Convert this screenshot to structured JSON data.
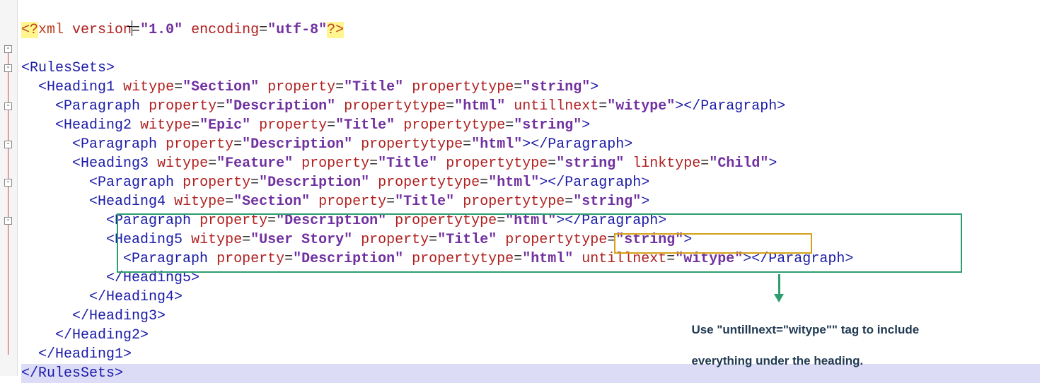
{
  "line01": {
    "pi_open": "<?",
    "pi_name": "xml",
    "attr1": "version",
    "val1": "\"1.0\"",
    "attr2": "encoding",
    "val2": "\"utf-8\"",
    "pi_close": "?>"
  },
  "line03": {
    "tag": "<RulesSets>"
  },
  "line04": {
    "open": "<Heading1",
    "a1": "witype",
    "v1": "\"Section\"",
    "a2": "property",
    "v2": "\"Title\"",
    "a3": "propertytype",
    "v3": "\"string\"",
    "close": ">"
  },
  "line05": {
    "open": "<Paragraph",
    "a1": "property",
    "v1": "\"Description\"",
    "a2": "propertytype",
    "v2": "\"html\"",
    "a3": "untillnext",
    "v3": "\"witype\"",
    "close": "></Paragraph>"
  },
  "line06": {
    "open": "<Heading2",
    "a1": "witype",
    "v1": "\"Epic\"",
    "a2": "property",
    "v2": "\"Title\"",
    "a3": "propertytype",
    "v3": "\"string\"",
    "close": ">"
  },
  "line07": {
    "open": "<Paragraph",
    "a1": "property",
    "v1": "\"Description\"",
    "a2": "propertytype",
    "v2": "\"html\"",
    "close": "></Paragraph>"
  },
  "line08": {
    "open": "<Heading3",
    "a1": "witype",
    "v1": "\"Feature\"",
    "a2": "property",
    "v2": "\"Title\"",
    "a3": "propertytype",
    "v3": "\"string\"",
    "a4": "linktype",
    "v4": "\"Child\"",
    "close": ">"
  },
  "line09": {
    "open": "<Paragraph",
    "a1": "property",
    "v1": "\"Description\"",
    "a2": "propertytype",
    "v2": "\"html\"",
    "close": "></Paragraph>"
  },
  "line10": {
    "open": "<Heading4",
    "a1": "witype",
    "v1": "\"Section\"",
    "a2": "property",
    "v2": "\"Title\"",
    "a3": "propertytype",
    "v3": "\"string\"",
    "close": ">"
  },
  "line11": {
    "open": "<Paragraph",
    "a1": "property",
    "v1": "\"Description\"",
    "a2": "propertytype",
    "v2": "\"html\"",
    "close": "></Paragraph>"
  },
  "line12": {
    "open": "<Heading5",
    "a1": "witype",
    "v1": "\"User Story\"",
    "a2": "property",
    "v2": "\"Title\"",
    "a3": "propertytype",
    "v3": "\"string\"",
    "close": ">"
  },
  "line13": {
    "open": "<Paragraph",
    "a1": "property",
    "v1": "\"Description\"",
    "a2": "propertytype",
    "v2": "\"html\"",
    "a3": "untillnext",
    "v3": "\"witype\"",
    "close": "></Paragraph>"
  },
  "line14": {
    "tag": "</Heading5>"
  },
  "line15": {
    "tag": "</Heading4>"
  },
  "line16": {
    "tag": "</Heading3>"
  },
  "line17": {
    "tag": "</Heading2>"
  },
  "line18": {
    "tag": "</Heading1>"
  },
  "line19": {
    "tag": "</RulesSets>"
  },
  "callout": {
    "l1": "Use \"untillnext=\"witype\"\" tag to include",
    "l2": "everything under the heading."
  }
}
